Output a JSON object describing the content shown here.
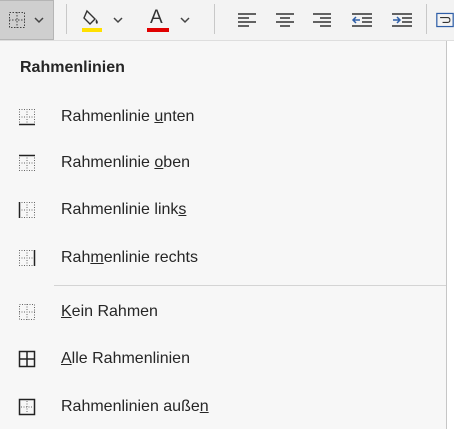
{
  "ribbon": {
    "buttons": [
      {
        "name": "borders-button",
        "icon": "borders-icon"
      },
      {
        "name": "fill-color-button",
        "icon": "paint-bucket-icon",
        "color": "#ffe000"
      },
      {
        "name": "font-color-button",
        "icon": "font-color-icon",
        "glyph": "A",
        "color": "#e00000"
      },
      {
        "name": "align-left-button",
        "icon": "align-left-icon"
      },
      {
        "name": "align-center-button",
        "icon": "align-center-icon"
      },
      {
        "name": "align-right-button",
        "icon": "align-right-icon"
      },
      {
        "name": "decrease-indent-button",
        "icon": "decrease-indent-icon"
      },
      {
        "name": "increase-indent-button",
        "icon": "increase-indent-icon"
      },
      {
        "name": "wrap-text-button",
        "icon": "wrap-text-icon"
      }
    ],
    "accent": "#2f5fa8"
  },
  "menu": {
    "title": "Rahmenlinien",
    "items": [
      {
        "pre": "Rahmenlinie ",
        "key": "u",
        "post": "nten",
        "icon": "border-bottom-icon"
      },
      {
        "pre": "Rahmenlinie ",
        "key": "o",
        "post": "ben",
        "icon": "border-top-icon"
      },
      {
        "pre": "Rahmenlinie link",
        "key": "s",
        "post": "",
        "icon": "border-left-icon"
      },
      {
        "pre": "Rah",
        "key": "m",
        "post": "enlinie rechts",
        "icon": "border-right-icon"
      },
      {
        "pre": "",
        "key": "K",
        "post": "ein Rahmen",
        "icon": "no-border-icon"
      },
      {
        "pre": "",
        "key": "A",
        "post": "lle Rahmenlinien",
        "icon": "all-borders-icon"
      },
      {
        "pre": "Rahmenlinien auße",
        "key": "n",
        "post": "",
        "icon": "outside-borders-icon"
      }
    ]
  }
}
